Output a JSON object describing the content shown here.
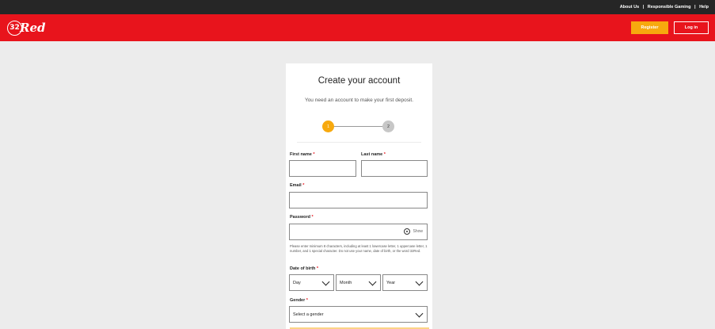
{
  "topbar": {
    "about": "About Us",
    "sep1": "|",
    "responsible": "Responsible Gaming",
    "sep2": "|",
    "help": "Help"
  },
  "header": {
    "logo_number": "32",
    "logo_word": "Red",
    "register_label": "Register",
    "login_label": "Log in"
  },
  "colors": {
    "brand_red": "#e8141c",
    "accent_orange": "#f7a90e",
    "topbar": "#262626",
    "page_bg": "#ececec"
  },
  "form": {
    "title": "Create your account",
    "subtitle": "You need an account to make your first deposit.",
    "steps": [
      "1",
      "2"
    ],
    "first_name_label": "First name",
    "last_name_label": "Last name",
    "email_label": "Email",
    "password_label": "Password",
    "required_mark": "*",
    "show_label": "Show",
    "password_hint": "Please enter minimum 8 characters, including at least 1 lowercase letter, 1 uppercase letter, 1 number, and 1 special character. Do not use your name, date of birth, or the word 32Red.",
    "dob_label": "Date of birth",
    "day_placeholder": "Day",
    "month_placeholder": "Month",
    "year_placeholder": "Year",
    "gender_label": "Gender",
    "gender_placeholder": "Select a gender"
  }
}
